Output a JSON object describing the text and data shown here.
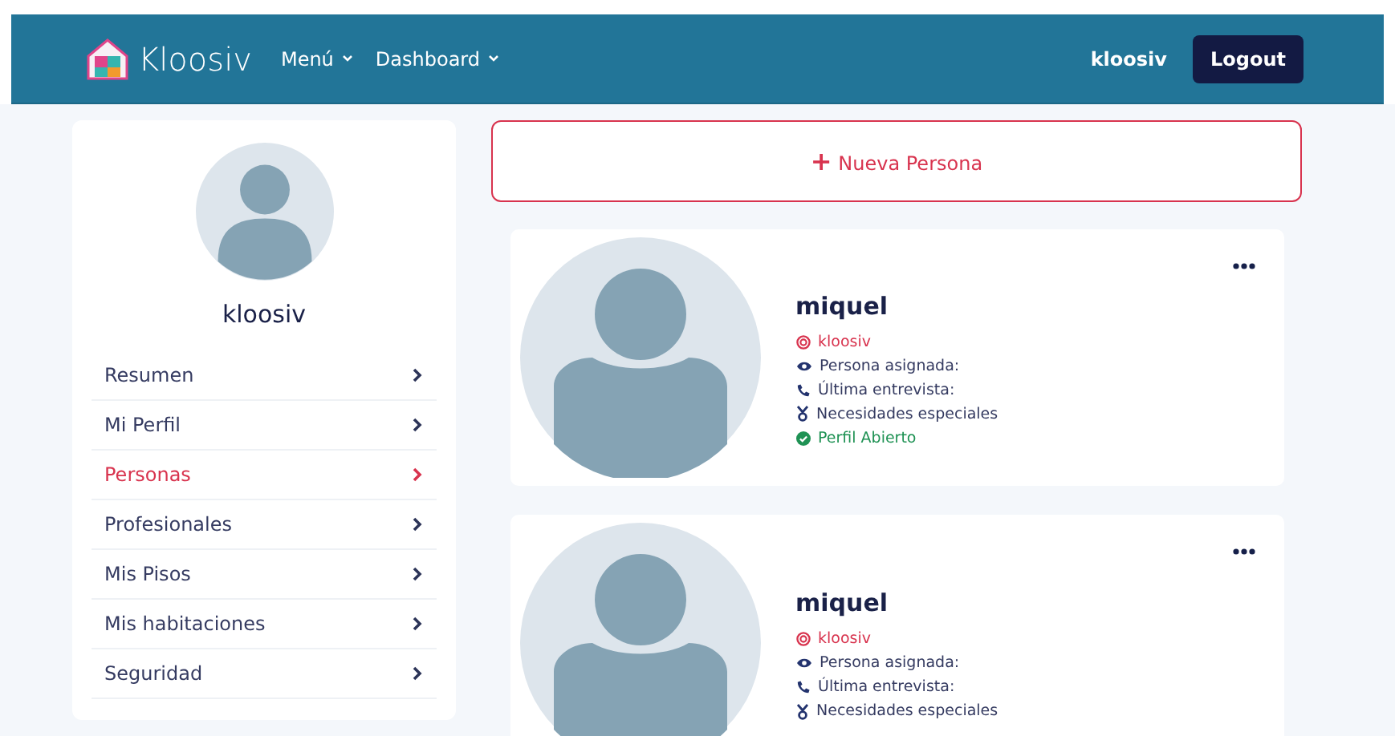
{
  "header": {
    "brand": "Kloosiv",
    "nav": [
      {
        "label": "Menú"
      },
      {
        "label": "Dashboard"
      }
    ],
    "user": "kloosiv",
    "logout": "Logout"
  },
  "sidebar": {
    "username": "kloosiv",
    "items": [
      {
        "label": "Resumen",
        "selected": false
      },
      {
        "label": "Mi Perfil",
        "selected": false
      },
      {
        "label": "Personas",
        "selected": true
      },
      {
        "label": "Profesionales",
        "selected": false
      },
      {
        "label": "Mis Pisos",
        "selected": false
      },
      {
        "label": "Mis habitaciones",
        "selected": false
      },
      {
        "label": "Seguridad",
        "selected": false
      }
    ]
  },
  "new_button": {
    "icon": "+",
    "label": "Nueva Persona"
  },
  "persons": [
    {
      "name": "miquel",
      "details": [
        {
          "kind": "owner",
          "text": "kloosiv"
        },
        {
          "kind": "assigned",
          "text": "Persona asignada:"
        },
        {
          "kind": "interview",
          "text": "Última entrevista:"
        },
        {
          "kind": "needs",
          "text": "Necesidades especiales"
        },
        {
          "kind": "status",
          "text": "Perfil Abierto"
        }
      ]
    },
    {
      "name": "miquel",
      "details": [
        {
          "kind": "owner",
          "text": "kloosiv"
        },
        {
          "kind": "assigned",
          "text": "Persona asignada:"
        },
        {
          "kind": "interview",
          "text": "Última entrevista:"
        },
        {
          "kind": "needs",
          "text": "Necesidades especiales"
        }
      ]
    }
  ]
}
